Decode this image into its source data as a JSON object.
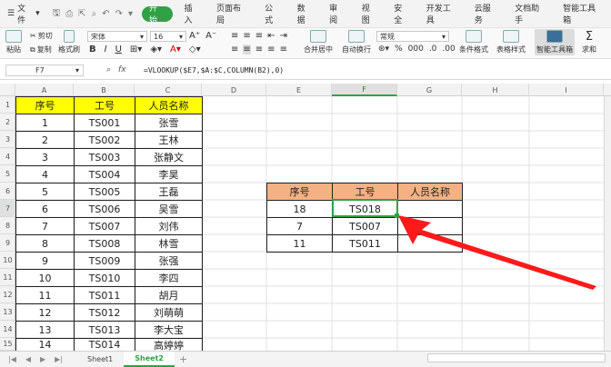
{
  "menu": {
    "file": "文件",
    "tabs": [
      "开始",
      "插入",
      "页面布局",
      "公式",
      "数据",
      "审阅",
      "视图",
      "安全",
      "开发工具",
      "云服务",
      "文档助手",
      "智能工具箱"
    ],
    "active_tab": 0
  },
  "ribbon": {
    "paste": "粘贴",
    "cut": "剪切",
    "copy": "复制",
    "format_painter": "格式刷",
    "font_name": "宋体",
    "font_size": "16",
    "bold": "B",
    "italic": "I",
    "underline": "U",
    "merge_center": "合并居中",
    "wrap": "自动换行",
    "number_format": "常规",
    "cond_format": "条件格式",
    "table_style": "表格样式",
    "smart_toolbox": "智能工具箱",
    "sum": "求和"
  },
  "formula_bar": {
    "name_box": "F7",
    "fx": "fx",
    "formula": "=VLOOKUP($E7,$A:$C,COLUMN(B2),0)"
  },
  "columns": [
    "A",
    "B",
    "C",
    "D",
    "E",
    "F",
    "G",
    "H",
    "I"
  ],
  "rows": [
    "1",
    "2",
    "3",
    "4",
    "5",
    "6",
    "7",
    "8",
    "9",
    "10",
    "11",
    "12",
    "13",
    "14",
    "15"
  ],
  "table1": {
    "headers": [
      "序号",
      "工号",
      "人员名称"
    ],
    "rows": [
      [
        "1",
        "TS001",
        "张雪"
      ],
      [
        "2",
        "TS002",
        "王林"
      ],
      [
        "3",
        "TS003",
        "张静文"
      ],
      [
        "4",
        "TS004",
        "李昊"
      ],
      [
        "5",
        "TS005",
        "王磊"
      ],
      [
        "6",
        "TS006",
        "吴雪"
      ],
      [
        "7",
        "TS007",
        "刘伟"
      ],
      [
        "8",
        "TS008",
        "林雪"
      ],
      [
        "9",
        "TS009",
        "张强"
      ],
      [
        "10",
        "TS010",
        "李四"
      ],
      [
        "11",
        "TS011",
        "胡月"
      ],
      [
        "12",
        "TS012",
        "刘萌萌"
      ],
      [
        "13",
        "TS013",
        "李大宝"
      ],
      [
        "14",
        "TS014",
        "高婷婷"
      ]
    ]
  },
  "table2": {
    "headers": [
      "序号",
      "工号",
      "人员名称"
    ],
    "rows": [
      [
        "18",
        "TS018",
        ""
      ],
      [
        "7",
        "TS007",
        ""
      ],
      [
        "11",
        "TS011",
        ""
      ]
    ]
  },
  "sheets": [
    "Sheet1",
    "Sheet2"
  ],
  "active_sheet": 1,
  "colors": {
    "accent": "#2fa245",
    "header_yellow": "#ffff00",
    "header_orange": "#f4b183",
    "arrow": "#ff1a1a"
  }
}
